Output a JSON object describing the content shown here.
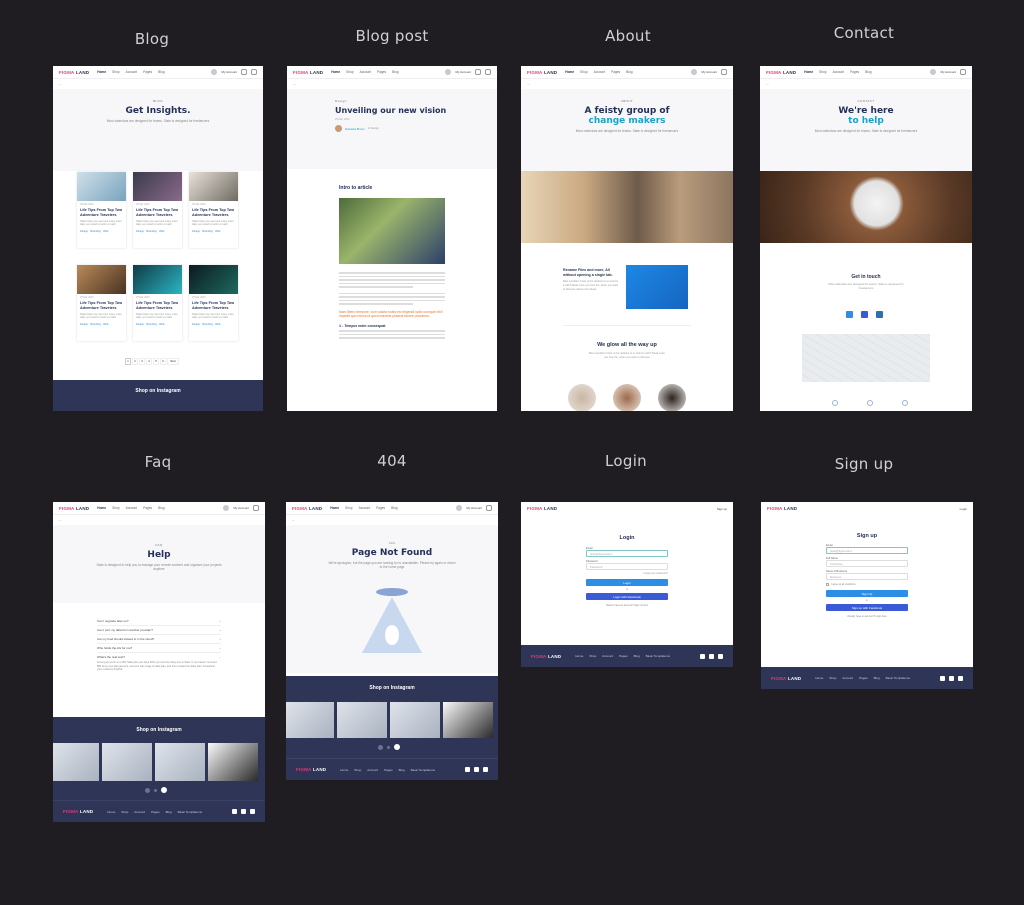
{
  "labels": {
    "blog": "Blog",
    "blog_post": "Blog post",
    "about": "About",
    "contact": "Contact",
    "faq": "Faq",
    "not_found": "404",
    "login": "Login",
    "signup": "Sign up"
  },
  "site": {
    "logo_a": "FIGMA",
    "logo_b": "LAND",
    "menu": [
      "Home",
      "Shop",
      "Account",
      "Pages",
      "Blog"
    ],
    "account": "My Account",
    "footer_menu": [
      "Home",
      "Shop",
      "Account",
      "Pages",
      "Blog",
      "Basic Templatemo"
    ]
  },
  "blog": {
    "kicker": "BLOG",
    "title": "Get Insights.",
    "sub": "Most calendars are designed for teams. Slate is designed for freelancers",
    "card_date": "25 Mar 2020",
    "card_title": "Life Tips From Top Two Adventure Travelers",
    "card_desc": "Slate helps you see how many more days you need to work to reach",
    "card_tags": "Design · Branding · Web",
    "pager": [
      "1",
      "2",
      "3",
      "4",
      "5",
      "6",
      "Next"
    ],
    "instagram": "Shop on Instagram"
  },
  "post": {
    "category": "Design",
    "title": "Unveiling our new vision",
    "date": "25 Mar 2020",
    "author": "Rebekka Brown",
    "author_role": "In Design",
    "intro": "Intro to article",
    "quote": "Nam libero tempore, cum soluta nobis est eligendi optio cumque nihil impedit quo minus id quod maxime placeat facere possimus.",
    "section": "1 - Tempor enim consequat"
  },
  "about": {
    "kicker": "ABOUT",
    "title_a": "A feisty group of",
    "title_b": "change makers",
    "sub": "Most calendars are designed for teams. Slate is designed for freelancers",
    "block_title": "Rename Files and more, All without opening a single tab.",
    "block_text": "Best condition Color is the rainbow or to rank for it with? Read more you how the, when you want to discover about more ideas",
    "team_title": "We glow all the way up",
    "team_sub": "Best condition Color is the rainbow or to rank for with? Read more you how the, when you want to discover"
  },
  "contact": {
    "kicker": "CONTACT",
    "title_a": "We're here",
    "title_b": "to help",
    "sub": "Most calendars are designed for teams. Slate is designed for freelancers",
    "touch": "Get in touch",
    "touch_sub": "Most calendars are designed for teams. Slate is designed for Freelancers"
  },
  "faq": {
    "kicker": "FAQ",
    "title": "Help",
    "sub": "Slate is designed to help you to manage your remote workers and organize your projects anytime",
    "questions": [
      "Can I upgrade later on?",
      "Can I port my data from another provider?",
      "Are my food should slowed to in the cloud?",
      "Who holds the AG for me?",
      "What's the real cost?"
    ],
    "answer": "As long as you'd on a 40% Slate plan you have 90% you can't be costly due to Slate. If you haven't removed $50 since your last payment, and your can usage of daily plan, and then created the Slate plan. Freelancer you're about to PayPal.",
    "instagram": "Shop on Instagram"
  },
  "not_found": {
    "kicker": "404",
    "title": "Page Not Found",
    "sub": "We're apologize, but the page you are looking for is unavailable. Please try again or return to the home page",
    "instagram": "Shop on Instagram"
  },
  "login": {
    "nav_right": "Sign up",
    "title": "Login",
    "email_label": "Email",
    "email_ph": "hello@figma.land",
    "pass_label": "Password",
    "pass_ph": "Password",
    "forgot": "Forgot your password?",
    "btn": "Login",
    "or": "or",
    "fb": "Login with Facebook",
    "footer_text": "Haven't have an account? Sign Up here"
  },
  "signup": {
    "nav_right": "Login",
    "title": "Sign up",
    "email_label": "Email",
    "email_ph": "hello@figma.land",
    "name_label": "Full Name",
    "name_ph": "Full Name",
    "biz_label": "Name of Business",
    "biz_ph": "Business",
    "agree": "I agree to all conditions",
    "btn": "Sign Up",
    "or": "or",
    "fb": "Sign up with Facebook",
    "footer_text": "Already have an account? Login here"
  },
  "colors": {
    "navy": "#243057",
    "accent": "#1aa3c9",
    "primary": "#2d8ee6",
    "facebook": "#3b5bd6",
    "dark_band": "#2f3556",
    "orange_quote": "#e9772a"
  }
}
